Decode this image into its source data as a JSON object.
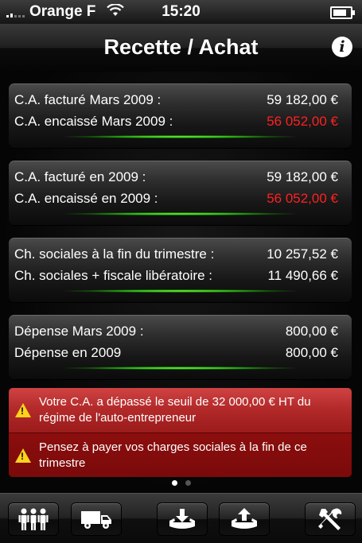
{
  "status": {
    "carrier": "Orange F",
    "time": "15:20",
    "battery_level": 0.8
  },
  "header": {
    "title": "Recette / Achat",
    "info_icon": "info-icon"
  },
  "panels": [
    {
      "rows": [
        {
          "label": "C.A. facturé Mars 2009 :",
          "value": "59 182,00 €",
          "highlight": false
        },
        {
          "label": "C.A. encaissé Mars 2009 :",
          "value": "56 052,00 €",
          "highlight": true
        }
      ]
    },
    {
      "rows": [
        {
          "label": "C.A. facturé en 2009 :",
          "value": "59 182,00 €",
          "highlight": false
        },
        {
          "label": "C.A. encaissé en 2009 :",
          "value": "56 052,00 €",
          "highlight": true
        }
      ]
    },
    {
      "rows": [
        {
          "label": "Ch. sociales à la fin du trimestre :",
          "value": "10 257,52 €",
          "highlight": false
        },
        {
          "label": "Ch. sociales + fiscale libératoire :",
          "value": "11 490,66 €",
          "highlight": false
        }
      ]
    },
    {
      "rows": [
        {
          "label": "Dépense Mars 2009 :",
          "value": "800,00 €",
          "highlight": false
        },
        {
          "label": "Dépense en 2009",
          "value": "800,00 €",
          "highlight": false
        }
      ]
    }
  ],
  "alerts": [
    {
      "icon": "warning-icon",
      "text": "Votre C.A. a dépassé le seuil de 32 000,00 € HT du régime de l'auto-entrepreneur"
    },
    {
      "icon": "warning-icon",
      "text": "Pensez à payer vos charges sociales à la fin de ce trimestre"
    }
  ],
  "page_control": {
    "pages": 2,
    "current": 1
  },
  "toolbar": {
    "buttons": [
      {
        "icon": "clients-icon"
      },
      {
        "icon": "delivery-truck-icon"
      },
      {
        "icon": "download-tray-icon"
      },
      {
        "icon": "upload-tray-icon"
      },
      {
        "icon": "tools-icon"
      }
    ]
  },
  "colors": {
    "highlight_red": "#ff2020",
    "alert_red": "#b42a2a",
    "glow_green": "#2cb815"
  }
}
